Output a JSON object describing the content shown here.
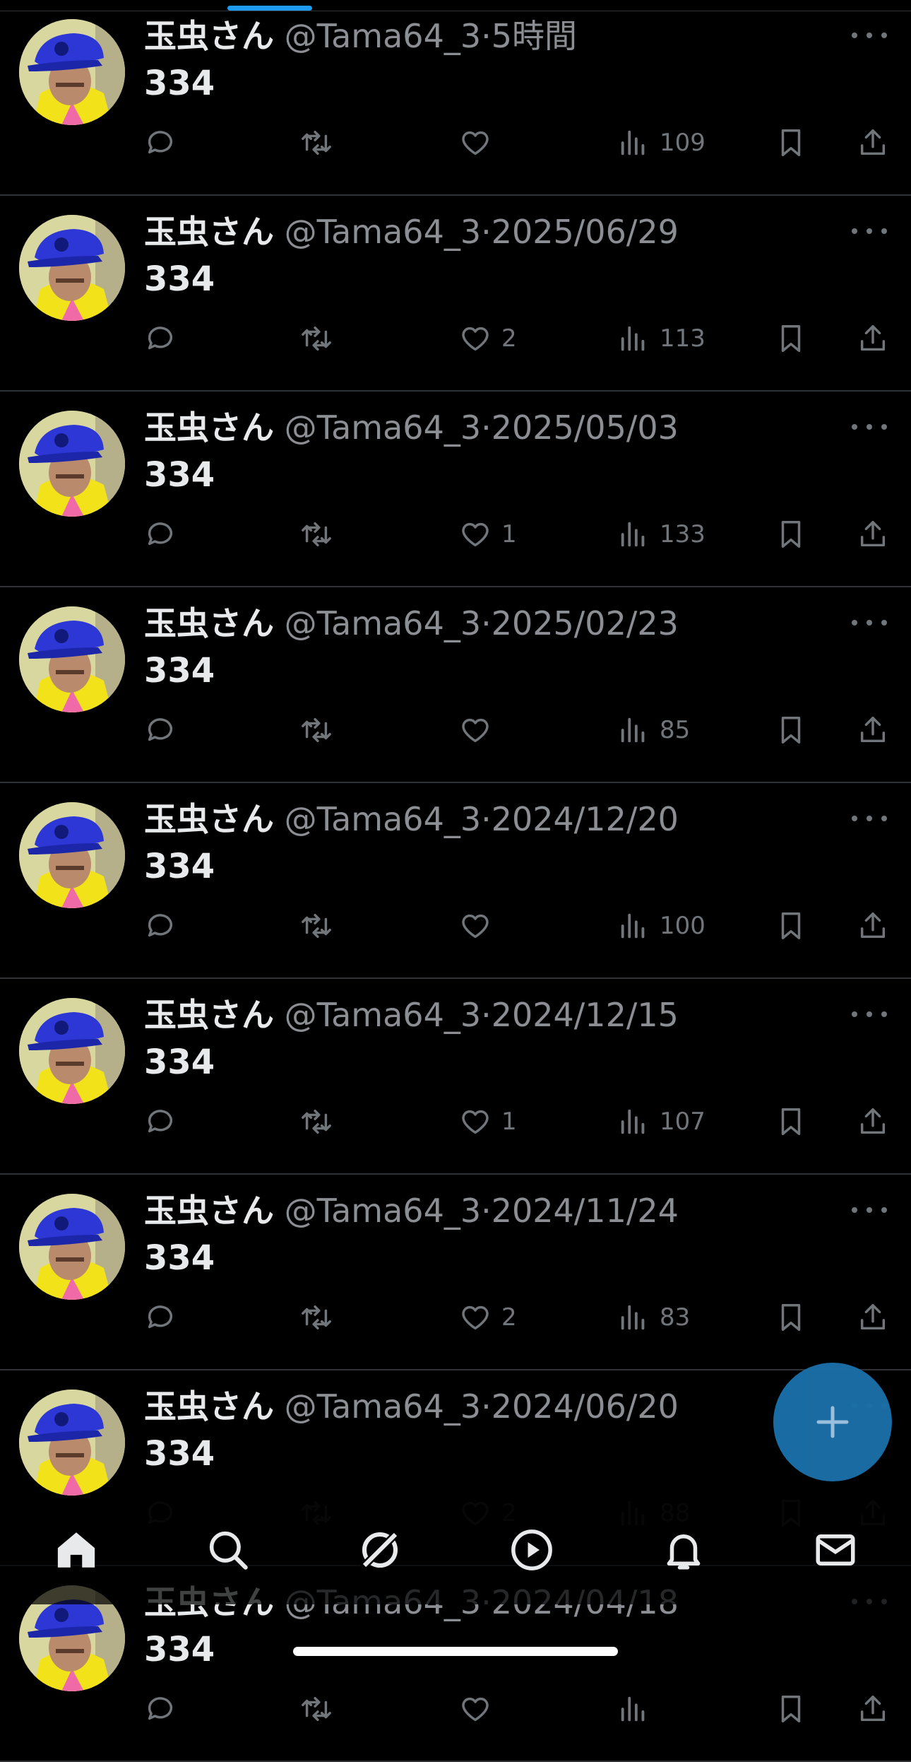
{
  "user": {
    "name": "玉虫さん",
    "handle": "@Tama64_3",
    "separator": "·"
  },
  "posts": [
    {
      "time": "5時間",
      "text": "334",
      "replies": "",
      "retweets": "",
      "likes": "",
      "views": "109"
    },
    {
      "time": "2025/06/29",
      "text": "334",
      "replies": "",
      "retweets": "",
      "likes": "2",
      "views": "113"
    },
    {
      "time": "2025/05/03",
      "text": "334",
      "replies": "",
      "retweets": "",
      "likes": "1",
      "views": "133"
    },
    {
      "time": "2025/02/23",
      "text": "334",
      "replies": "",
      "retweets": "",
      "likes": "",
      "views": "85"
    },
    {
      "time": "2024/12/20",
      "text": "334",
      "replies": "",
      "retweets": "",
      "likes": "",
      "views": "100"
    },
    {
      "time": "2024/12/15",
      "text": "334",
      "replies": "",
      "retweets": "",
      "likes": "1",
      "views": "107"
    },
    {
      "time": "2024/11/24",
      "text": "334",
      "replies": "",
      "retweets": "",
      "likes": "2",
      "views": "83"
    },
    {
      "time": "2024/06/20",
      "text": "334",
      "replies": "",
      "retweets": "",
      "likes": "2",
      "views": "88"
    },
    {
      "time": "2024/04/18",
      "text": "334",
      "replies": "",
      "retweets": "",
      "likes": "",
      "views": ""
    }
  ],
  "icons": {
    "reply": "reply-icon",
    "retweet": "retweet-icon",
    "like": "heart-icon",
    "views": "views-icon",
    "bookmark": "bookmark-icon",
    "share": "share-icon",
    "more": "more-icon",
    "compose": "plus-icon"
  },
  "tabbar": [
    {
      "name": "home",
      "icon": "home-icon",
      "active": true
    },
    {
      "name": "search",
      "icon": "search-icon",
      "active": false
    },
    {
      "name": "grok",
      "icon": "grok-icon",
      "active": false
    },
    {
      "name": "video",
      "icon": "play-icon",
      "active": false
    },
    {
      "name": "notifications",
      "icon": "bell-icon",
      "active": false
    },
    {
      "name": "messages",
      "icon": "mail-icon",
      "active": false
    }
  ],
  "colors": {
    "accent": "#1d9bf0",
    "fab": "#1a6fa8",
    "background": "#000000",
    "muted": "#71767b"
  }
}
